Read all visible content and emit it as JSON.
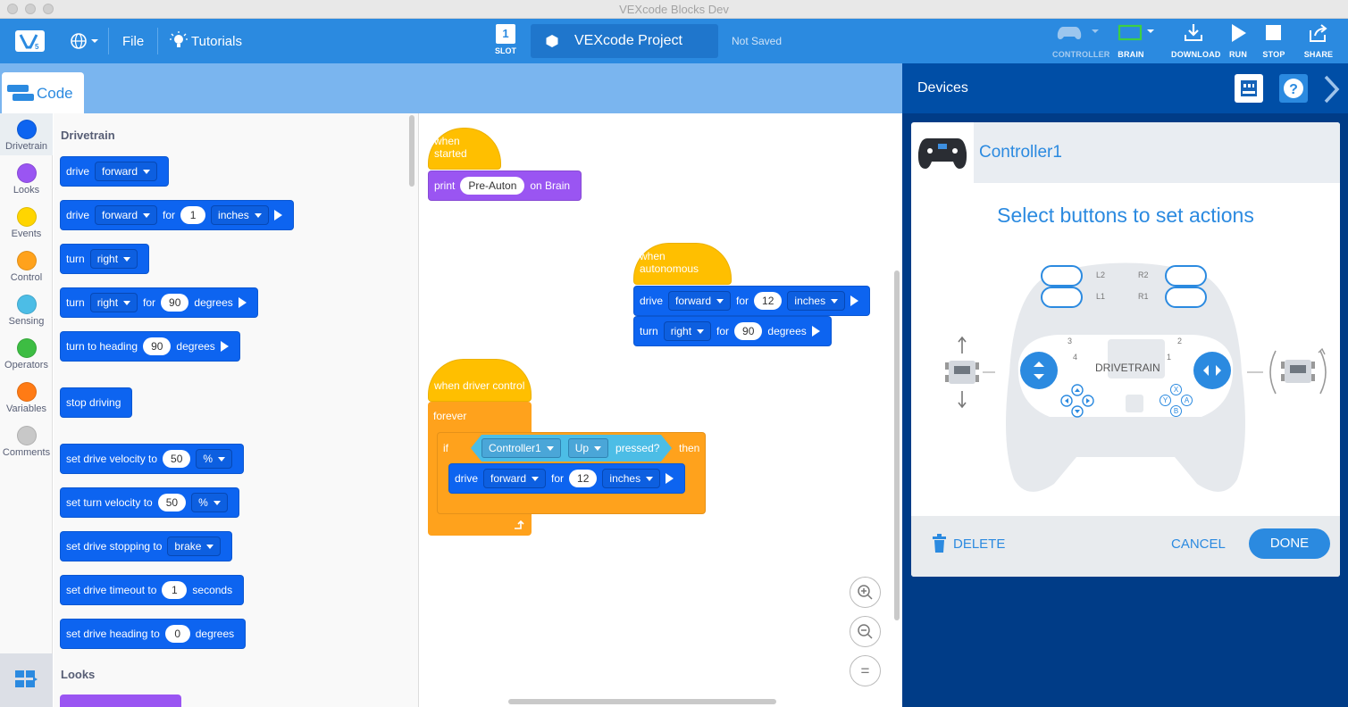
{
  "window": {
    "title": "VEXcode Blocks Dev"
  },
  "toolbar": {
    "file": "File",
    "tutorials": "Tutorials",
    "slot_number": "1",
    "slot_label": "SLOT",
    "project_name": "VEXcode Project",
    "save_status": "Not Saved",
    "controller": "CONTROLLER",
    "brain": "BRAIN",
    "download": "DOWNLOAD",
    "run": "RUN",
    "stop": "STOP",
    "share": "SHARE"
  },
  "code_tab": {
    "label": "Code"
  },
  "categories": [
    {
      "label": "Drivetrain",
      "color": "#0d64f0"
    },
    {
      "label": "Looks",
      "color": "#9a55f2"
    },
    {
      "label": "Events",
      "color": "#ffd500"
    },
    {
      "label": "Control",
      "color": "#ffa21c"
    },
    {
      "label": "Sensing",
      "color": "#4cbde6"
    },
    {
      "label": "Operators",
      "color": "#3dbd43"
    },
    {
      "label": "Variables",
      "color": "#ff7b15"
    },
    {
      "label": "Comments",
      "color": "#c8c8c8"
    }
  ],
  "palette": {
    "drivetrain_heading": "Drivetrain",
    "looks_heading": "Looks",
    "b1": {
      "t1": "drive",
      "d1": "forward"
    },
    "b2": {
      "t1": "drive",
      "d1": "forward",
      "t2": "for",
      "v1": "1",
      "d2": "inches"
    },
    "b3": {
      "t1": "turn",
      "d1": "right"
    },
    "b4": {
      "t1": "turn",
      "d1": "right",
      "t2": "for",
      "v1": "90",
      "t3": "degrees"
    },
    "b5": {
      "t1": "turn to heading",
      "v1": "90",
      "t2": "degrees"
    },
    "b6": {
      "t1": "stop driving"
    },
    "b7": {
      "t1": "set drive velocity to",
      "v1": "50",
      "d1": "%"
    },
    "b8": {
      "t1": "set turn velocity to",
      "v1": "50",
      "d1": "%"
    },
    "b9": {
      "t1": "set drive stopping to",
      "d1": "brake"
    },
    "b10": {
      "t1": "set drive timeout to",
      "v1": "1",
      "t2": "seconds"
    },
    "b11": {
      "t1": "set drive heading to",
      "v1": "0",
      "t2": "degrees"
    }
  },
  "workspace": {
    "s1": {
      "hat": "when started",
      "print": "print",
      "text": "Pre-Auton",
      "on": "on Brain"
    },
    "s2": {
      "hat": "when autonomous",
      "drive": "drive",
      "dir": "forward",
      "for": "for",
      "dist": "12",
      "unit": "inches",
      "turn": "turn",
      "tdir": "right",
      "tfor": "for",
      "deg": "90",
      "degunit": "degrees"
    },
    "s3": {
      "hat": "when driver control",
      "forever": "forever",
      "if": "if",
      "controller": "Controller1",
      "button": "Up",
      "pressed": "pressed?",
      "then": "then",
      "drive": "drive",
      "dir": "forward",
      "for": "for",
      "dist": "12",
      "unit": "inches"
    }
  },
  "zoom": {
    "in": "+",
    "out": "−",
    "reset": "="
  },
  "devices": {
    "title": "Devices",
    "device_name": "Controller1",
    "instruction": "Select buttons to set actions",
    "drivetrain_label": "DRIVETRAIN",
    "labels": {
      "l2": "L2",
      "l1": "L1",
      "r2": "R2",
      "r1": "R1",
      "axis3": "3",
      "axis4": "4",
      "axis2": "2",
      "axis1": "1",
      "x": "X",
      "y": "Y",
      "a": "A",
      "b": "B"
    },
    "delete": "DELETE",
    "cancel": "CANCEL",
    "done": "DONE"
  }
}
